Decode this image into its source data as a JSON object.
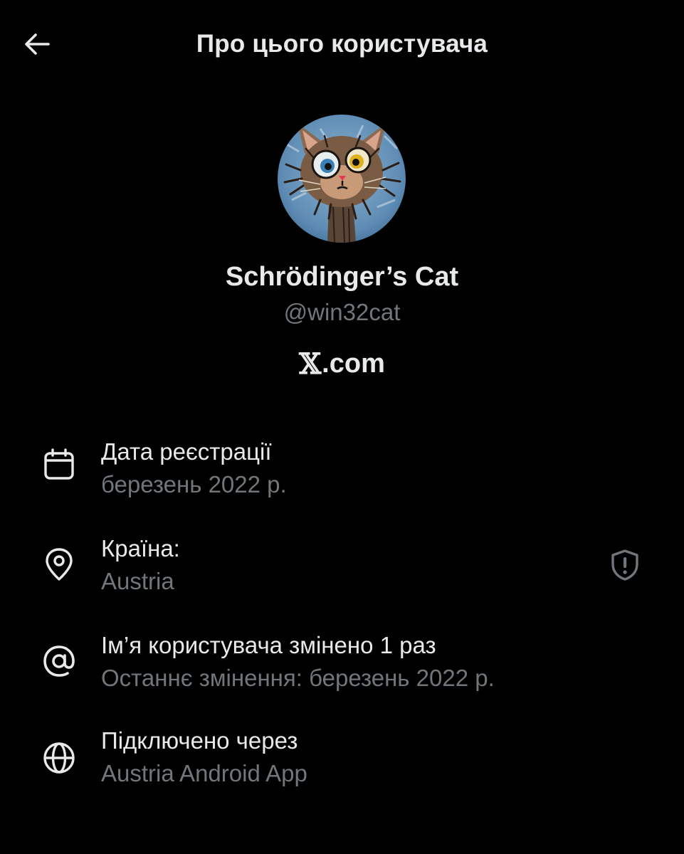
{
  "header": {
    "title": "Про цього користувача",
    "back_icon": "arrow-left-icon"
  },
  "profile": {
    "display_name": "Schrödinger’s Cat",
    "handle": "@win32cat",
    "platform_x": "𝕏",
    "platform_rest": ".com"
  },
  "details": [
    {
      "icon": "calendar-icon",
      "title": "Дата реєстрації",
      "value": "березень 2022 р."
    },
    {
      "icon": "location-pin-icon",
      "title": "Країна:",
      "value": "Austria",
      "action_icon": "shield-alert-icon"
    },
    {
      "icon": "at-sign-icon",
      "title": "Ім’я користувача змінено 1 раз",
      "value": "Останнє змінення: березень 2022 р."
    },
    {
      "icon": "globe-icon",
      "title": "Підключено через",
      "value": "Austria Android App"
    }
  ],
  "colors": {
    "background": "#000000",
    "primary_text": "#e7e9ea",
    "secondary_text": "#71767b"
  }
}
